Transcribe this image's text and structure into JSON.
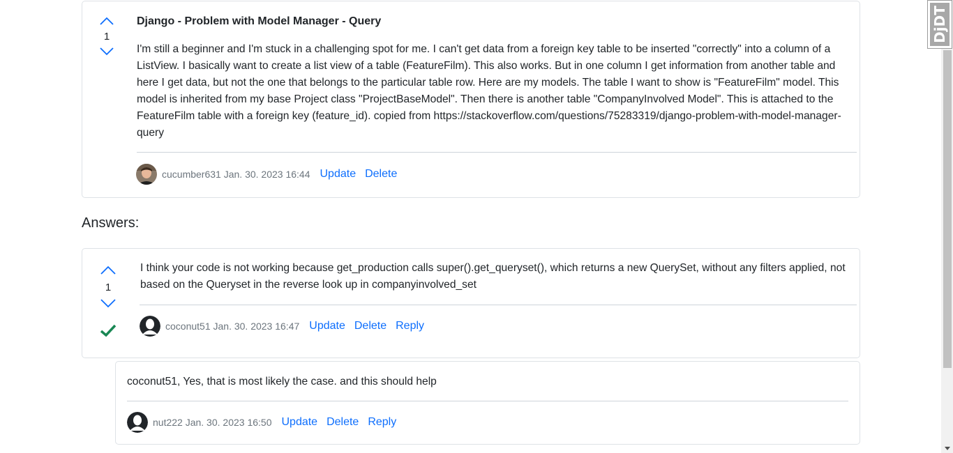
{
  "question": {
    "votes": "1",
    "title": "Django - Problem with Model Manager - Query",
    "body": "I'm still a beginner and I'm stuck in a challenging spot for me. I can't get data from a foreign key table to be inserted \"correctly\" into a column of a ListView. I basically want to create a list view of a table (FeatureFilm). This also works. But in one column I get information from another table and here I get data, but not the one that belongs to the particular table row. Here are my models. The table I want to show is \"FeatureFilm\" model. This model is inherited from my base Project class \"ProjectBaseModel\". Then there is another table \"CompanyInvolved Model\". This is attached to the FeatureFilm table with a foreign key (feature_id). copied from https://stackoverflow.com/questions/75283319/django-problem-with-model-manager-query",
    "author": "cucumber631 Jan. 30. 2023 16:44",
    "update_label": "Update",
    "delete_label": "Delete"
  },
  "answers_heading": "Answers:",
  "answer": {
    "votes": "1",
    "accepted": true,
    "body": "I think your code is not working because get_production calls super().get_queryset(), which returns a new QuerySet, without any filters applied, not based on the Queryset in the reverse look up in companyinvolved_set",
    "author": "coconut51 Jan. 30. 2023 16:47",
    "update_label": "Update",
    "delete_label": "Delete",
    "reply_label": "Reply"
  },
  "reply": {
    "body": "coconut51, Yes, that is most likely the case. and this should help",
    "author": "nut222 Jan. 30. 2023 16:50",
    "update_label": "Update",
    "delete_label": "Delete",
    "reply_label": "Reply"
  },
  "extension_badge": "DjDT",
  "colors": {
    "link": "#0d6efd",
    "accepted_check": "#198754",
    "chevron": "#0d6efd"
  }
}
